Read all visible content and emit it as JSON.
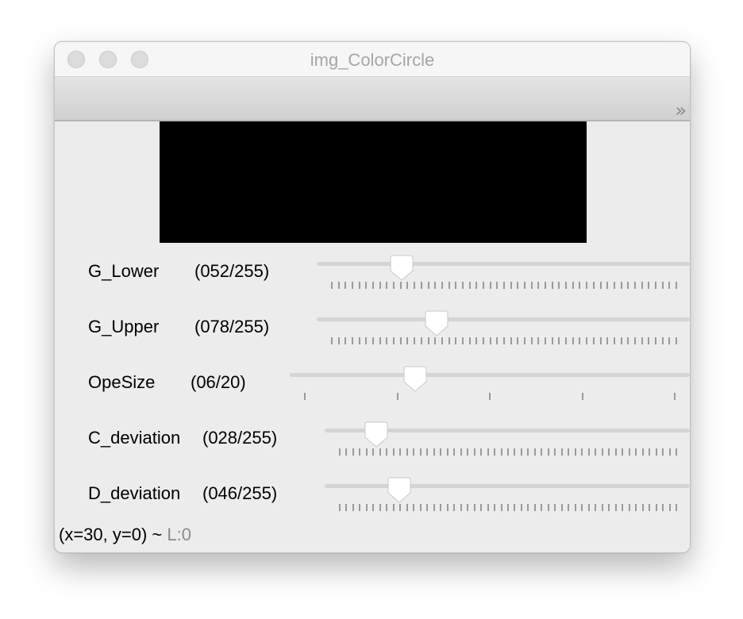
{
  "window": {
    "title": "img_ColorCircle"
  },
  "toolbar": {
    "overflow_glyph": "»"
  },
  "sliders": [
    {
      "label": "G_Lower",
      "value_text": "(052/255)",
      "value": 52,
      "max": 255,
      "tick_count": 51
    },
    {
      "label": "G_Upper",
      "value_text": "(078/255)",
      "value": 78,
      "max": 255,
      "tick_count": 51
    },
    {
      "label": "OpeSize",
      "value_text": "(06/20)",
      "value": 6,
      "max": 20,
      "tick_count": 5
    },
    {
      "label": "C_deviation",
      "value_text": "(028/255)",
      "value": 28,
      "max": 255,
      "tick_count": 51
    },
    {
      "label": "D_deviation",
      "value_text": "(046/255)",
      "value": 46,
      "max": 255,
      "tick_count": 51
    }
  ],
  "status": {
    "coords": "(x=30, y=0) ~ ",
    "level": "L:0"
  },
  "colors": {
    "image_background": "#000000",
    "window_background": "#ececec"
  }
}
